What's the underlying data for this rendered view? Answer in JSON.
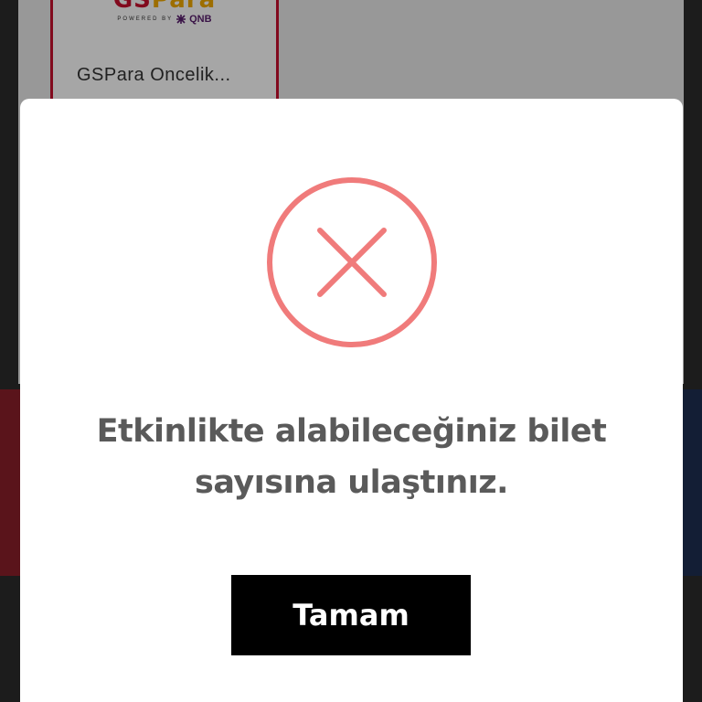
{
  "background": {
    "card": {
      "logo": {
        "wordmark_red": "GS",
        "wordmark_gold": "Para",
        "powered_by": "POWERED BY",
        "brand": "QNB"
      },
      "title": "GSPara Oncelik..."
    }
  },
  "modal": {
    "icon": "error-x-circle-icon",
    "message": "Etkinlikte alabileceğiniz bilet sayısına ulaştınız.",
    "ok_label": "Tamam"
  },
  "colors": {
    "error_icon": "#f07b7b",
    "button_bg": "#000000",
    "message_text": "#5a5a5a",
    "card_border": "#c8102e"
  }
}
